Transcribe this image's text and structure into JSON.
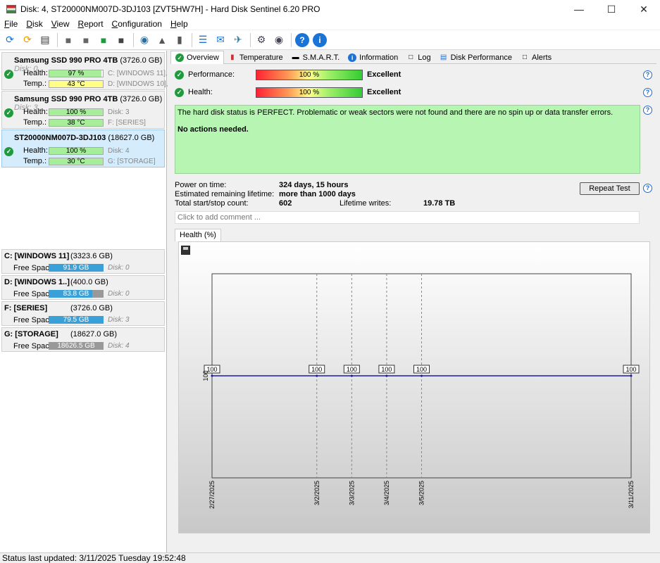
{
  "window": {
    "title": "Disk: 4, ST20000NM007D-3DJ103 [ZVT5HW7H]  -  Hard Disk Sentinel 6.20 PRO"
  },
  "menu": [
    "File",
    "Disk",
    "View",
    "Report",
    "Configuration",
    "Help"
  ],
  "disks": [
    {
      "name": "Samsung SSD 990 PRO 4TB",
      "size": "(3726.0 GB)",
      "disk": "Disk: 0",
      "health_label": "Health:",
      "health": "97 %",
      "health_pct": 97,
      "temp_label": "Temp.:",
      "temp": "43 °C",
      "temp_color": "#ffff88",
      "vol1": "C: [WINDOWS 11],",
      "vol2": "D: [WINDOWS 10],",
      "selected": false
    },
    {
      "name": "Samsung SSD 990 PRO 4TB",
      "size": "(3726.0 GB)",
      "disk": "Disk: 3",
      "health_label": "Health:",
      "health": "100 %",
      "health_pct": 100,
      "temp_label": "Temp.:",
      "temp": "38 °C",
      "temp_color": "#a6ee9a",
      "vol1": "Disk: 3",
      "vol2": "F: [SERIES]",
      "selected": false
    },
    {
      "name": "ST20000NM007D-3DJ103",
      "size": "(18627.0 GB)",
      "disk": "",
      "health_label": "Health:",
      "health": "100 %",
      "health_pct": 100,
      "temp_label": "Temp.:",
      "temp": "30 °C",
      "temp_color": "#a6ee9a",
      "vol1": "Disk: 4",
      "vol2": "G: [STORAGE]",
      "selected": true
    }
  ],
  "volumes": [
    {
      "name": "C: [WINDOWS 11]",
      "size": "(3323.6 GB)",
      "free_label": "Free Space",
      "free": "91.9 GB",
      "free_fraction": 1.0,
      "disk": "Disk: 0"
    },
    {
      "name": "D: [WINDOWS 1..]",
      "size": "(400.0 GB)",
      "free_label": "Free Space",
      "free": "83.8 GB",
      "free_fraction": 0.79,
      "disk": "Disk: 0"
    },
    {
      "name": "F: [SERIES]",
      "size": "(3726.0 GB)",
      "free_label": "Free Space",
      "free": "79.5 GB",
      "free_fraction": 1.0,
      "disk": "Disk: 3"
    },
    {
      "name": "G: [STORAGE]",
      "size": "(18627.0 GB)",
      "free_label": "Free Space",
      "free": "18626.5 GB",
      "free_fraction": 0.0,
      "disk": "Disk: 4"
    }
  ],
  "tabs": [
    "Overview",
    "Temperature",
    "S.M.A.R.T.",
    "Information",
    "Log",
    "Disk Performance",
    "Alerts"
  ],
  "overview": {
    "performance_label": "Performance:",
    "performance_value": "100 %",
    "performance_rating": "Excellent",
    "health_label": "Health:",
    "health_value": "100 %",
    "health_rating": "Excellent",
    "status_text": "The hard disk status is PERFECT. Problematic or weak sectors were not found and there are no spin up or data transfer errors.",
    "status_action": "No actions needed.",
    "power_on_label": "Power on time:",
    "power_on_value": "324 days, 15 hours",
    "lifetime_label": "Estimated remaining lifetime:",
    "lifetime_value": "more than 1000 days",
    "startstop_label": "Total start/stop count:",
    "startstop_value": "602",
    "writes_label": "Lifetime writes:",
    "writes_value": "19.78 TB",
    "repeat_button": "Repeat Test",
    "comment_placeholder": "Click to add comment ...",
    "chart_tab": "Health (%)"
  },
  "chart_data": {
    "type": "line",
    "x": [
      "2/27/2025",
      "3/2/2025",
      "3/3/2025",
      "3/4/2025",
      "3/5/2025",
      "3/11/2025"
    ],
    "x_days": [
      0,
      3,
      4,
      5,
      6,
      12
    ],
    "values": [
      100,
      100,
      100,
      100,
      100,
      100
    ],
    "y_tick": "100",
    "line_color": "#1a1aa8"
  },
  "statusbar": {
    "text": "Status last updated: 3/11/2025 Tuesday 19:52:48"
  }
}
